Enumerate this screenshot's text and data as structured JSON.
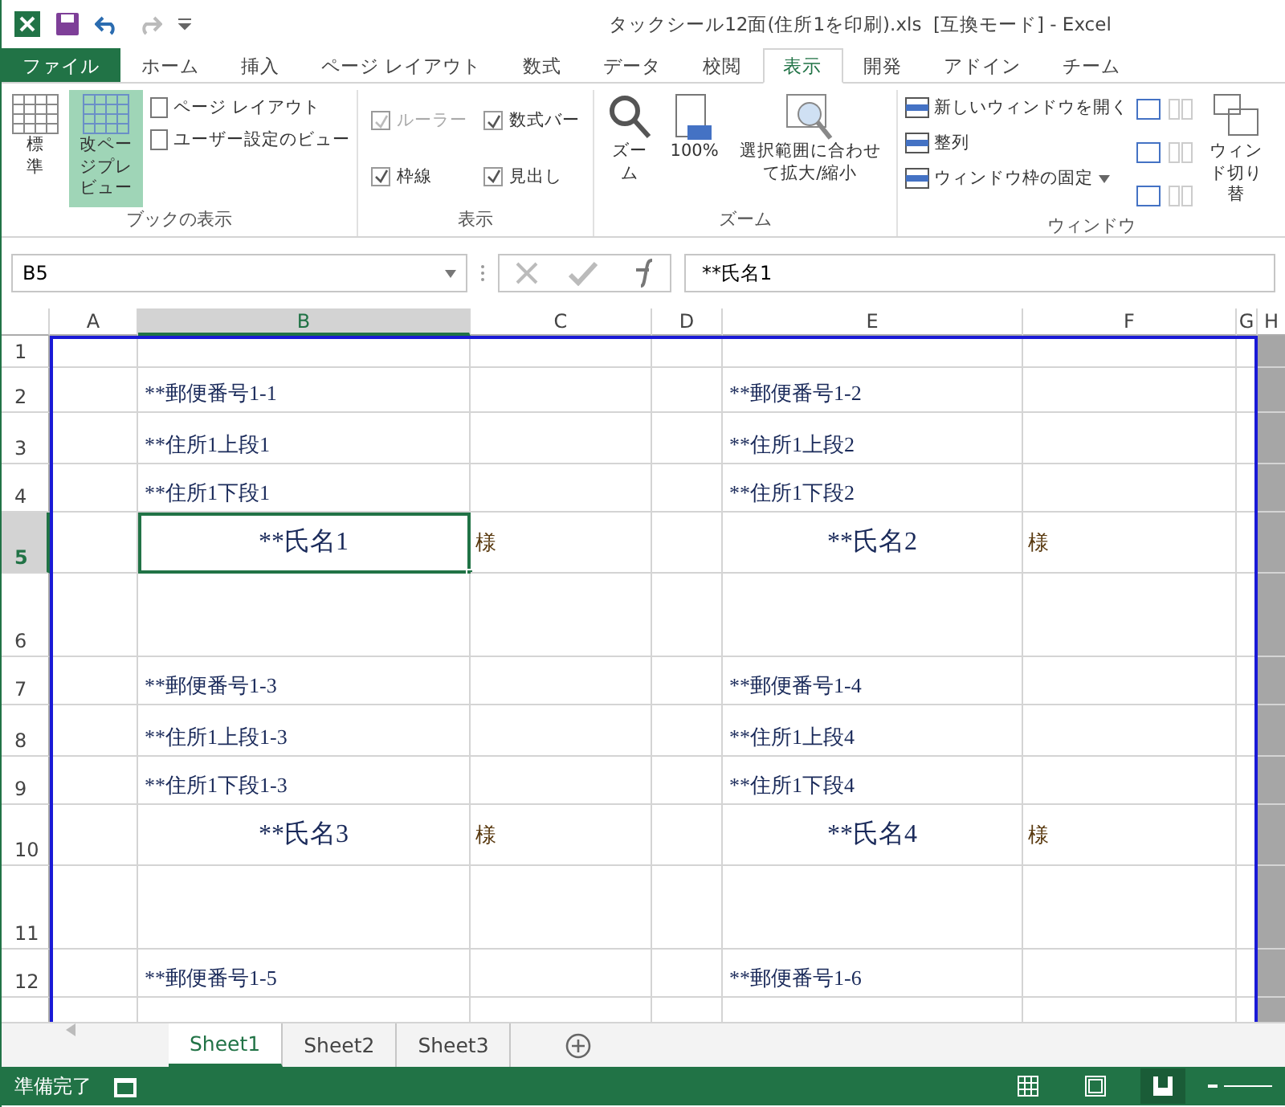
{
  "window": {
    "title": "タックシール12面(住所1を印刷).xls  [互換モード] - Excel"
  },
  "tabs": [
    {
      "label": "ファイル",
      "kind": "file",
      "selected": false
    },
    {
      "label": "ホーム",
      "kind": "tab",
      "selected": false
    },
    {
      "label": "挿入",
      "kind": "tab",
      "selected": false
    },
    {
      "label": "ページ レイアウト",
      "kind": "tab",
      "selected": false
    },
    {
      "label": "数式",
      "kind": "tab",
      "selected": false
    },
    {
      "label": "データ",
      "kind": "tab",
      "selected": false
    },
    {
      "label": "校閲",
      "kind": "tab",
      "selected": false
    },
    {
      "label": "表示",
      "kind": "tab",
      "selected": true
    },
    {
      "label": "開発",
      "kind": "tab",
      "selected": false
    },
    {
      "label": "アドイン",
      "kind": "tab",
      "selected": false
    },
    {
      "label": "チーム",
      "kind": "tab",
      "selected": false
    }
  ],
  "ribbon": {
    "workbook_views": {
      "label": "ブックの表示",
      "large": [
        {
          "label": "標準",
          "selected": false
        },
        {
          "label": "改ページプレビュー",
          "selected": true
        }
      ],
      "small": [
        "ページ レイアウト",
        "ユーザー設定のビュー"
      ]
    },
    "show": {
      "label": "表示",
      "checks": [
        {
          "label": "ルーラー",
          "checked": true,
          "disabled": true
        },
        {
          "label": "数式バー",
          "checked": true,
          "disabled": false
        },
        {
          "label": "枠線",
          "checked": true,
          "disabled": false
        },
        {
          "label": "見出し",
          "checked": true,
          "disabled": false
        }
      ]
    },
    "zoom": {
      "label": "ズーム",
      "buttons": [
        "ズーム",
        "100%",
        "選択範囲に合わせて拡大/縮小"
      ]
    },
    "window": {
      "label": "ウィンドウ",
      "small": [
        "新しいウィンドウを開く",
        "整列",
        "ウィンドウ枠の固定"
      ],
      "switch_label": "ウィンド切り替"
    }
  },
  "formula_bar": {
    "name_box": "B5",
    "value": "**氏名1"
  },
  "columns": [
    {
      "label": "A",
      "selected": false
    },
    {
      "label": "B",
      "selected": true
    },
    {
      "label": "C",
      "selected": false
    },
    {
      "label": "D",
      "selected": false
    },
    {
      "label": "E",
      "selected": false
    },
    {
      "label": "F",
      "selected": false
    },
    {
      "label": "G",
      "selected": false
    },
    {
      "label": "H",
      "selected": false
    }
  ],
  "rows": [
    {
      "label": "1",
      "selected": false,
      "cells": []
    },
    {
      "label": "2",
      "selected": false,
      "cells": [
        {
          "kind": "postal",
          "text": "**郵便番号1-1",
          "selected": false
        },
        {
          "kind": "postal",
          "text": "**郵便番号1-2",
          "selected": false
        }
      ]
    },
    {
      "label": "3",
      "selected": false,
      "cells": [
        {
          "kind": "address",
          "text": "**住所1上段1",
          "selected": false
        },
        {
          "kind": "address",
          "text": "**住所1上段2",
          "selected": false
        }
      ]
    },
    {
      "label": "4",
      "selected": false,
      "cells": [
        {
          "kind": "address",
          "text": "**住所1下段1",
          "selected": false
        },
        {
          "kind": "address",
          "text": "**住所1下段2",
          "selected": false
        }
      ]
    },
    {
      "label": "5",
      "selected": true,
      "cells": [
        {
          "kind": "name",
          "text": "**氏名1",
          "selected": true
        },
        {
          "kind": "honorific",
          "text": "様",
          "selected": false
        },
        {
          "kind": "name",
          "text": "**氏名2",
          "selected": false
        },
        {
          "kind": "honorific",
          "text": "様",
          "selected": false
        }
      ]
    },
    {
      "label": "6",
      "selected": false,
      "cells": []
    },
    {
      "label": "7",
      "selected": false,
      "cells": [
        {
          "kind": "postal",
          "text": "**郵便番号1-3",
          "selected": false
        },
        {
          "kind": "postal",
          "text": "**郵便番号1-4",
          "selected": false
        }
      ]
    },
    {
      "label": "8",
      "selected": false,
      "cells": [
        {
          "kind": "address",
          "text": "**住所1上段1-3",
          "selected": false
        },
        {
          "kind": "address",
          "text": "**住所1上段4",
          "selected": false
        }
      ]
    },
    {
      "label": "9",
      "selected": false,
      "cells": [
        {
          "kind": "address",
          "text": "**住所1下段1-3",
          "selected": false
        },
        {
          "kind": "address",
          "text": "**住所1下段4",
          "selected": false
        }
      ]
    },
    {
      "label": "10",
      "selected": false,
      "cells": [
        {
          "kind": "name",
          "text": "**氏名3",
          "selected": false
        },
        {
          "kind": "honorific",
          "text": "様",
          "selected": false
        },
        {
          "kind": "name",
          "text": "**氏名4",
          "selected": false
        },
        {
          "kind": "honorific",
          "text": "様",
          "selected": false
        }
      ]
    },
    {
      "label": "11",
      "selected": false,
      "cells": []
    },
    {
      "label": "12",
      "selected": false,
      "cells": [
        {
          "kind": "postal",
          "text": "**郵便番号1-5",
          "selected": false
        },
        {
          "kind": "postal",
          "text": "**郵便番号1-6",
          "selected": false
        }
      ]
    }
  ],
  "sheets": [
    {
      "label": "Sheet1",
      "selected": true
    },
    {
      "label": "Sheet2",
      "selected": false
    },
    {
      "label": "Sheet3",
      "selected": false
    }
  ],
  "status_bar": {
    "text": "準備完了",
    "views": [
      {
        "kind": "normal",
        "selected": false
      },
      {
        "kind": "layout",
        "selected": false
      },
      {
        "kind": "pagebreak",
        "selected": true
      }
    ]
  }
}
